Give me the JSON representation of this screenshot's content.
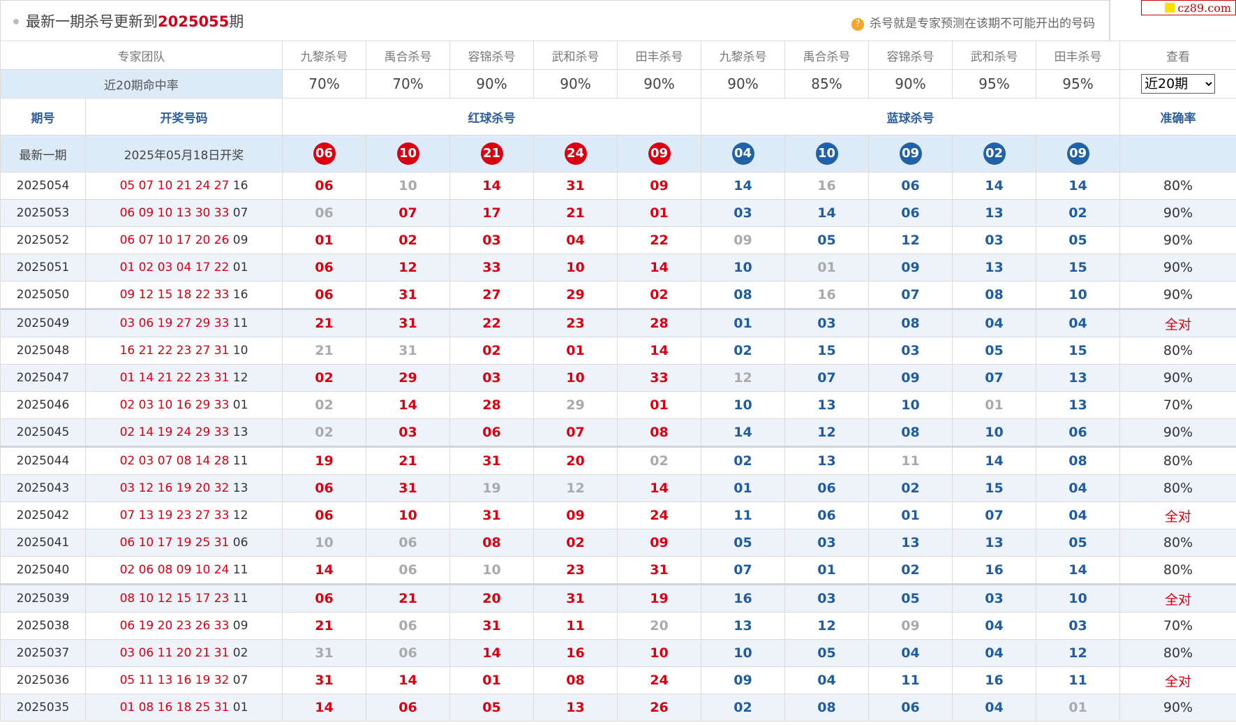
{
  "header": {
    "title_prefix": "最新一期杀号更新到",
    "title_period": "2025055",
    "title_suffix": "期",
    "note": "杀号就是专家预测在该期不可能开出的号码",
    "site_badge": "cz89.com"
  },
  "experts": {
    "team_label": "专家团队",
    "view_label": "查看",
    "names": [
      "九黎杀号",
      "禹合杀号",
      "容锦杀号",
      "武和杀号",
      "田丰杀号",
      "九黎杀号",
      "禹合杀号",
      "容锦杀号",
      "武和杀号",
      "田丰杀号"
    ],
    "rate_label": "近20期命中率",
    "rates": [
      "70%",
      "70%",
      "90%",
      "90%",
      "90%",
      "90%",
      "85%",
      "90%",
      "95%",
      "95%"
    ],
    "period_select": "近20期",
    "period_options": [
      "近20期"
    ]
  },
  "columns": {
    "issue": "期号",
    "draw": "开奖号码",
    "red_kill": "红球杀号",
    "blue_kill": "蓝球杀号",
    "accuracy": "准确率"
  },
  "latest": {
    "label": "最新一期",
    "date_text": "2025年05月18日开奖",
    "red": [
      "06",
      "10",
      "21",
      "24",
      "09"
    ],
    "blue": [
      "04",
      "10",
      "09",
      "02",
      "09"
    ]
  },
  "rows": [
    {
      "issue": "2025054",
      "red": "05 07 10 21 24 27",
      "blue": "16",
      "kills": [
        "06",
        "10",
        "14",
        "31",
        "09",
        "14",
        "16",
        "06",
        "14",
        "14"
      ],
      "miss": [
        1
      ],
      "bmiss": [
        1
      ],
      "acc": "80%"
    },
    {
      "issue": "2025053",
      "red": "06 09 10 13 30 33",
      "blue": "07",
      "kills": [
        "06",
        "07",
        "17",
        "21",
        "01",
        "03",
        "14",
        "06",
        "13",
        "02"
      ],
      "miss": [
        0
      ],
      "bmiss": [],
      "acc": "90%"
    },
    {
      "issue": "2025052",
      "red": "06 07 10 17 20 26",
      "blue": "09",
      "kills": [
        "01",
        "02",
        "03",
        "04",
        "22",
        "09",
        "05",
        "12",
        "03",
        "05"
      ],
      "miss": [],
      "bmiss": [
        0
      ],
      "acc": "90%"
    },
    {
      "issue": "2025051",
      "red": "01 02 03 04 17 22",
      "blue": "01",
      "kills": [
        "06",
        "12",
        "33",
        "10",
        "14",
        "10",
        "01",
        "09",
        "13",
        "15"
      ],
      "miss": [],
      "bmiss": [
        1
      ],
      "acc": "90%"
    },
    {
      "issue": "2025050",
      "red": "09 12 15 18 22 33",
      "blue": "16",
      "kills": [
        "06",
        "31",
        "27",
        "29",
        "02",
        "08",
        "16",
        "07",
        "08",
        "10"
      ],
      "miss": [],
      "bmiss": [
        1
      ],
      "acc": "90%"
    },
    {
      "issue": "2025049",
      "red": "03 06 19 27 29 33",
      "blue": "11",
      "kills": [
        "21",
        "31",
        "22",
        "23",
        "28",
        "01",
        "03",
        "08",
        "04",
        "04"
      ],
      "miss": [],
      "bmiss": [],
      "acc": "全对"
    },
    {
      "issue": "2025048",
      "red": "16 21 22 23 27 31",
      "blue": "10",
      "kills": [
        "21",
        "31",
        "02",
        "01",
        "14",
        "02",
        "15",
        "03",
        "05",
        "15"
      ],
      "miss": [
        0,
        1
      ],
      "bmiss": [],
      "acc": "80%"
    },
    {
      "issue": "2025047",
      "red": "01 14 21 22 23 31",
      "blue": "12",
      "kills": [
        "02",
        "29",
        "03",
        "10",
        "33",
        "12",
        "07",
        "09",
        "07",
        "13"
      ],
      "miss": [],
      "bmiss": [
        0
      ],
      "acc": "90%"
    },
    {
      "issue": "2025046",
      "red": "02 03 10 16 29 33",
      "blue": "01",
      "kills": [
        "02",
        "14",
        "28",
        "29",
        "01",
        "10",
        "13",
        "10",
        "01",
        "13"
      ],
      "miss": [
        0,
        3
      ],
      "bmiss": [
        3
      ],
      "acc": "70%"
    },
    {
      "issue": "2025045",
      "red": "02 14 19 24 29 33",
      "blue": "13",
      "kills": [
        "02",
        "03",
        "06",
        "07",
        "08",
        "14",
        "12",
        "08",
        "10",
        "06"
      ],
      "miss": [
        0
      ],
      "bmiss": [],
      "acc": "90%"
    },
    {
      "issue": "2025044",
      "red": "02 03 07 08 14 28",
      "blue": "11",
      "kills": [
        "19",
        "21",
        "31",
        "20",
        "02",
        "02",
        "13",
        "11",
        "14",
        "08"
      ],
      "miss": [
        4
      ],
      "bmiss": [
        2
      ],
      "acc": "80%"
    },
    {
      "issue": "2025043",
      "red": "03 12 16 19 20 32",
      "blue": "13",
      "kills": [
        "06",
        "31",
        "19",
        "12",
        "14",
        "01",
        "06",
        "02",
        "15",
        "04"
      ],
      "miss": [
        2,
        3
      ],
      "bmiss": [],
      "acc": "80%"
    },
    {
      "issue": "2025042",
      "red": "07 13 19 23 27 33",
      "blue": "12",
      "kills": [
        "06",
        "10",
        "31",
        "09",
        "24",
        "11",
        "06",
        "01",
        "07",
        "04"
      ],
      "miss": [],
      "bmiss": [],
      "acc": "全对"
    },
    {
      "issue": "2025041",
      "red": "06 10 17 19 25 31",
      "blue": "06",
      "kills": [
        "10",
        "06",
        "08",
        "02",
        "09",
        "05",
        "03",
        "13",
        "13",
        "05"
      ],
      "miss": [
        0,
        1
      ],
      "bmiss": [],
      "acc": "80%"
    },
    {
      "issue": "2025040",
      "red": "02 06 08 09 10 24",
      "blue": "11",
      "kills": [
        "14",
        "06",
        "10",
        "23",
        "31",
        "07",
        "01",
        "02",
        "16",
        "14"
      ],
      "miss": [
        1,
        2
      ],
      "bmiss": [],
      "acc": "80%"
    },
    {
      "issue": "2025039",
      "red": "08 10 12 15 17 23",
      "blue": "11",
      "kills": [
        "06",
        "21",
        "20",
        "31",
        "19",
        "16",
        "03",
        "05",
        "03",
        "10"
      ],
      "miss": [],
      "bmiss": [],
      "acc": "全对"
    },
    {
      "issue": "2025038",
      "red": "06 19 20 23 26 33",
      "blue": "09",
      "kills": [
        "21",
        "06",
        "31",
        "11",
        "20",
        "13",
        "12",
        "09",
        "04",
        "03"
      ],
      "miss": [
        1,
        4
      ],
      "bmiss": [
        2
      ],
      "acc": "70%"
    },
    {
      "issue": "2025037",
      "red": "03 06 11 20 21 31",
      "blue": "02",
      "kills": [
        "31",
        "06",
        "14",
        "16",
        "10",
        "10",
        "05",
        "04",
        "04",
        "12"
      ],
      "miss": [
        0,
        1
      ],
      "bmiss": [],
      "acc": "80%"
    },
    {
      "issue": "2025036",
      "red": "05 11 13 16 19 32",
      "blue": "07",
      "kills": [
        "31",
        "14",
        "01",
        "08",
        "24",
        "09",
        "04",
        "11",
        "16",
        "11"
      ],
      "miss": [],
      "bmiss": [],
      "acc": "全对"
    },
    {
      "issue": "2025035",
      "red": "01 08 16 18 25 31",
      "blue": "01",
      "kills": [
        "14",
        "06",
        "05",
        "13",
        "26",
        "02",
        "08",
        "06",
        "04",
        "01"
      ],
      "miss": [],
      "bmiss": [
        4
      ],
      "acc": "90%"
    }
  ]
}
